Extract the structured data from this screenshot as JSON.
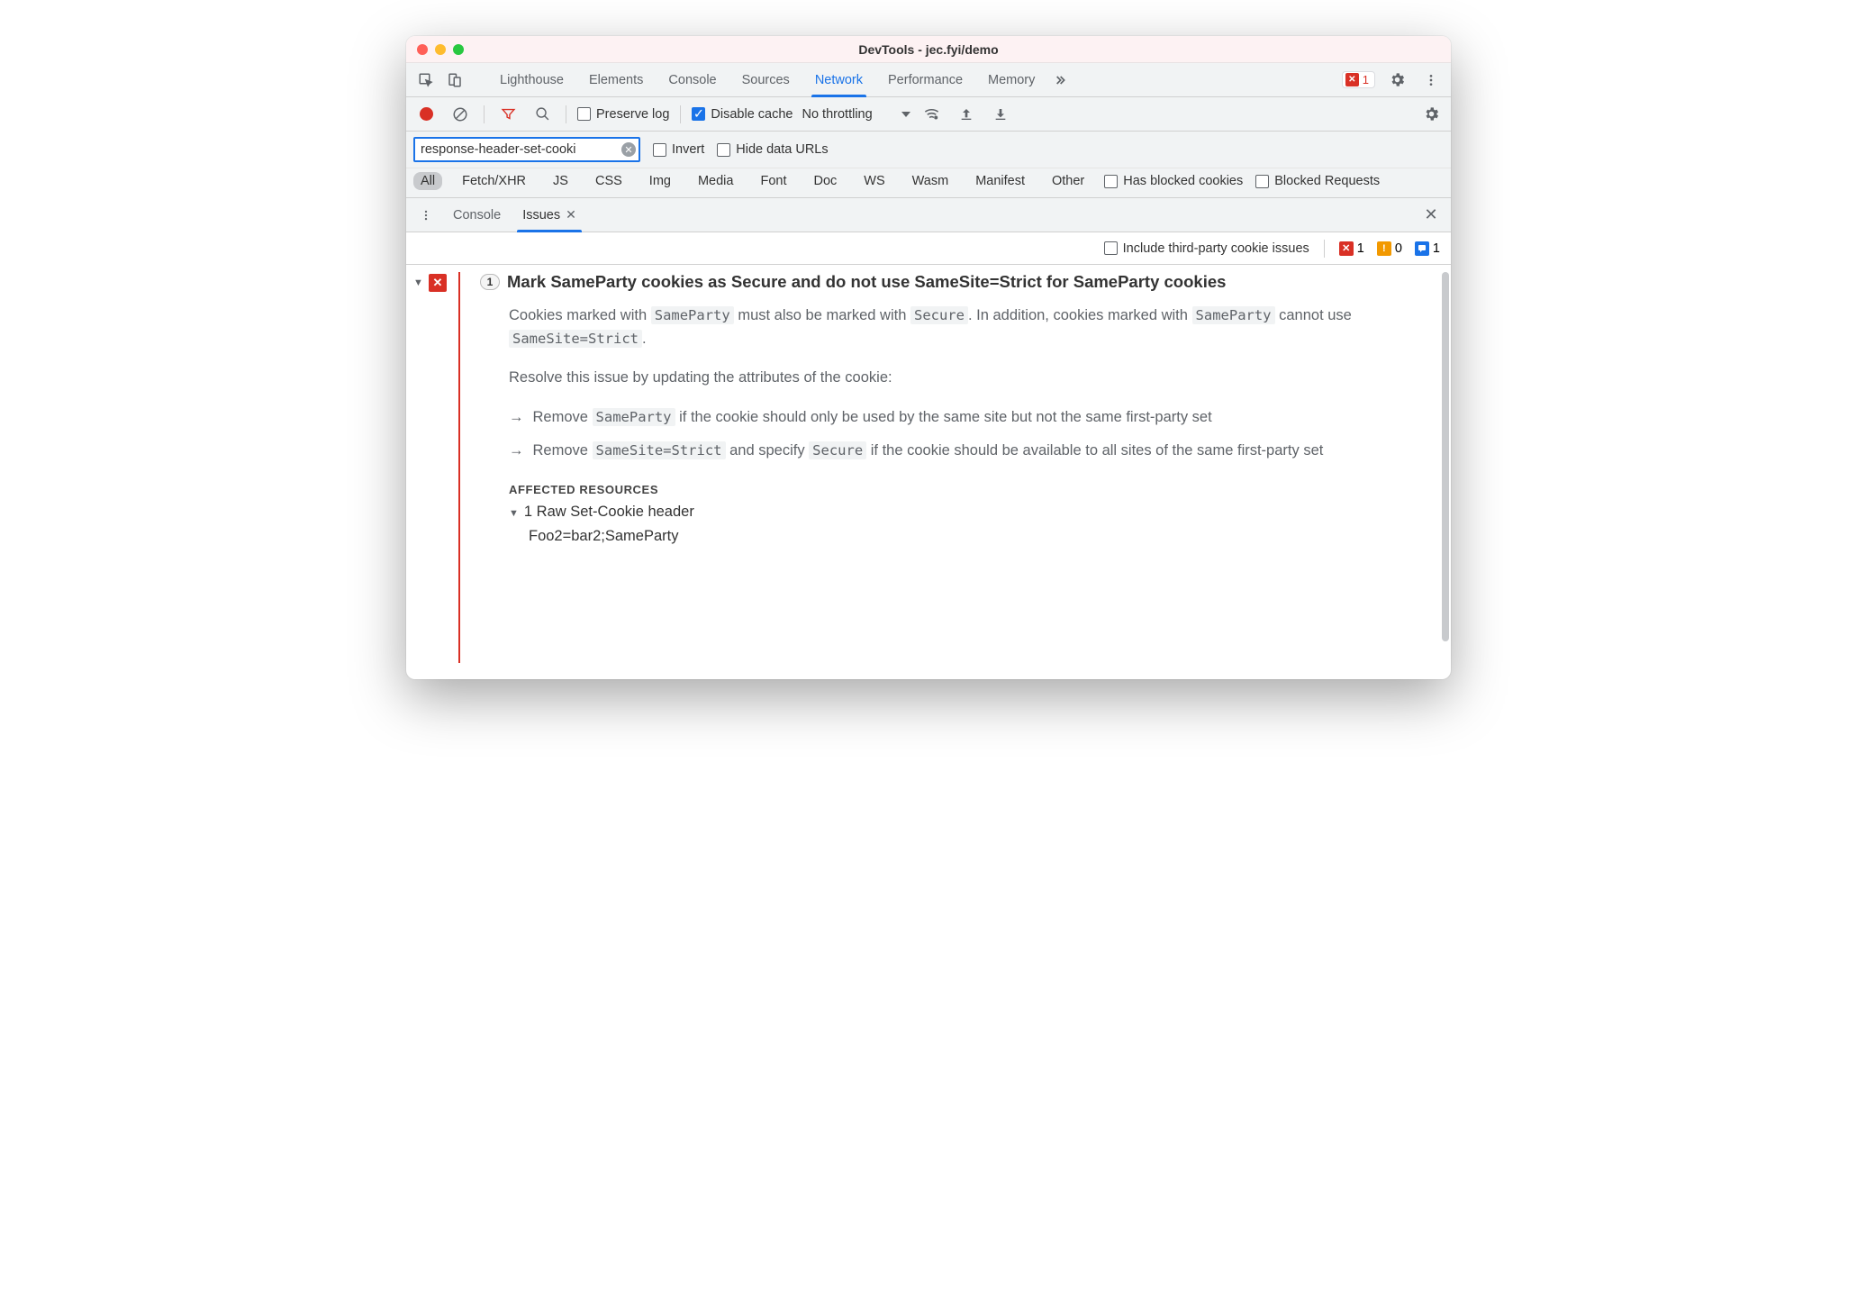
{
  "window": {
    "title": "DevTools - jec.fyi/demo"
  },
  "panels": {
    "list": [
      "Lighthouse",
      "Elements",
      "Console",
      "Sources",
      "Network",
      "Performance",
      "Memory"
    ],
    "active": "Network",
    "error_count": "1"
  },
  "network_toolbar": {
    "preserve_log": "Preserve log",
    "disable_cache": "Disable cache",
    "throttling": "No throttling"
  },
  "filter": {
    "value": "response-header-set-cooki",
    "invert": "Invert",
    "hide_data_urls": "Hide data URLs"
  },
  "types": {
    "items": [
      "All",
      "Fetch/XHR",
      "JS",
      "CSS",
      "Img",
      "Media",
      "Font",
      "Doc",
      "WS",
      "Wasm",
      "Manifest",
      "Other"
    ],
    "active": "All",
    "has_blocked": "Has blocked cookies",
    "blocked_req": "Blocked Requests"
  },
  "drawer": {
    "tabs": [
      "Console",
      "Issues"
    ],
    "active": "Issues"
  },
  "issues_bar": {
    "include_3p": "Include third-party cookie issues",
    "counts": {
      "error": "1",
      "warn": "0",
      "info": "1"
    }
  },
  "issue": {
    "count": "1",
    "title": "Mark SameParty cookies as Secure and do not use SameSite=Strict for SameParty cookies",
    "desc_p1a": "Cookies marked with ",
    "desc_p1b": " must also be marked with ",
    "desc_p1c": ". In addition, cookies marked with ",
    "desc_p1d": " cannot use ",
    "desc_p1e": ".",
    "code_sameparty": "SameParty",
    "code_secure": "Secure",
    "code_strict": "SameSite=Strict",
    "resolve": "Resolve this issue by updating the attributes of the cookie:",
    "b1a": "Remove ",
    "b1b": " if the cookie should only be used by the same site but not the same first-party set",
    "b2a": "Remove ",
    "b2b": " and specify ",
    "b2c": " if the cookie should be available to all sites of the same first-party set",
    "affected_heading": "AFFECTED RESOURCES",
    "affected_row": "1 Raw Set-Cookie header",
    "affected_value": "Foo2=bar2;SameParty"
  }
}
